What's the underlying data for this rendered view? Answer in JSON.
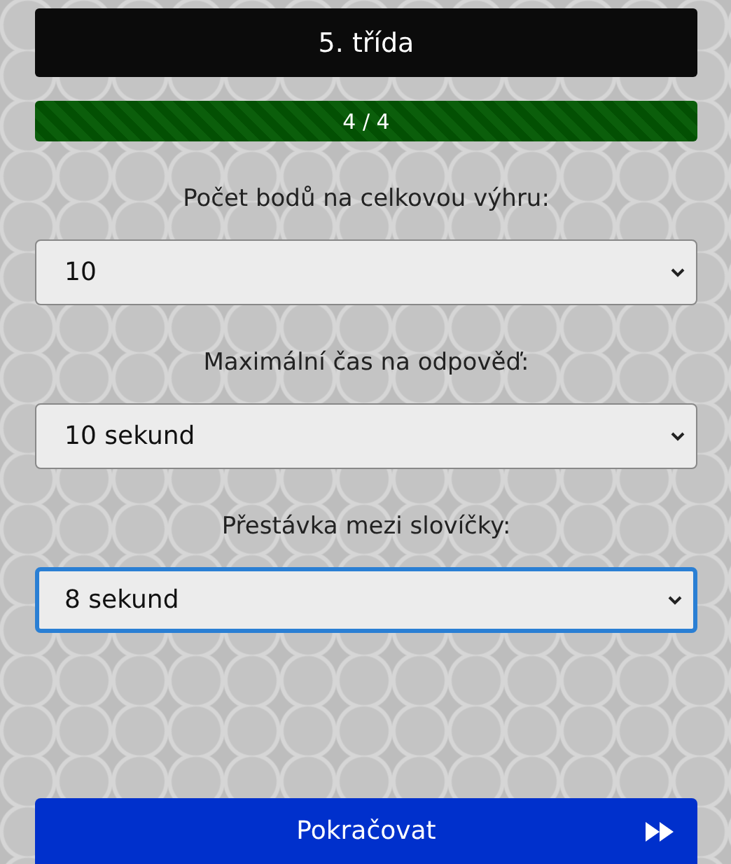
{
  "header": {
    "title": "5. třída"
  },
  "progress": {
    "reading": "4 / 4"
  },
  "settings": [
    {
      "label": "Počet bodů na celkovou výhru:",
      "value": "10",
      "focused": false
    },
    {
      "label": "Maximální čas na odpověď:",
      "value": "10 sekund",
      "focused": false
    },
    {
      "label": "Přestávka mezi slovíčky:",
      "value": "8 sekund",
      "focused": true
    }
  ],
  "continue_button": {
    "label": "Pokračovat"
  }
}
